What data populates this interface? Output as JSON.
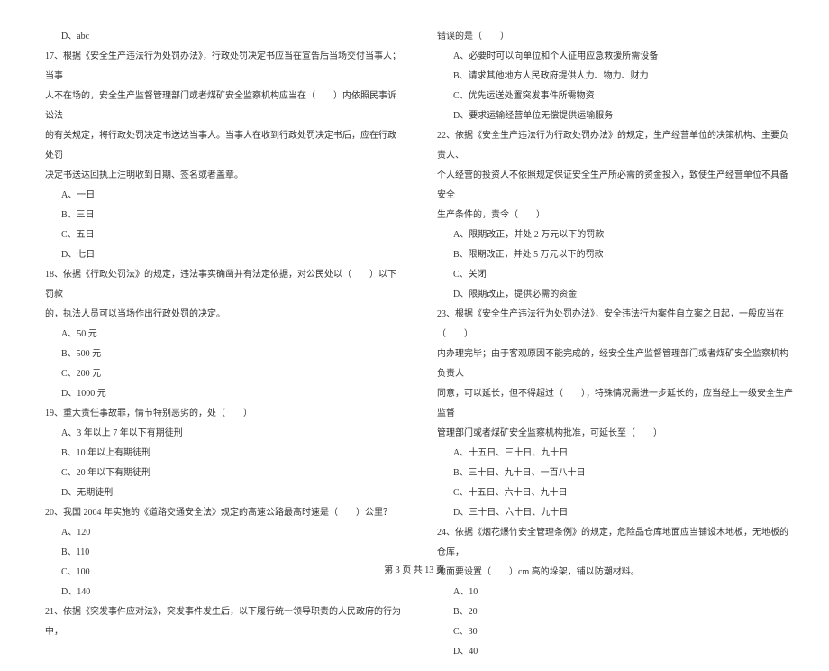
{
  "col1": {
    "lines": [
      {
        "cls": "indent-2",
        "t": "D、abc"
      },
      {
        "cls": "indent-1",
        "t": "17、根据《安全生产违法行为处罚办法》，行政处罚决定书应当在宣告后当场交付当事人；当事"
      },
      {
        "cls": "indent-1",
        "t": "人不在场的，安全生产监督管理部门或者煤矿安全监察机构应当在（　　）内依照民事诉讼法"
      },
      {
        "cls": "indent-1",
        "t": "的有关规定，将行政处罚决定书送达当事人。当事人在收到行政处罚决定书后，应在行政处罚"
      },
      {
        "cls": "indent-1",
        "t": "决定书送达回执上注明收到日期、签名或者盖章。"
      },
      {
        "cls": "indent-2",
        "t": "A、一日"
      },
      {
        "cls": "indent-2",
        "t": "B、三日"
      },
      {
        "cls": "indent-2",
        "t": "C、五日"
      },
      {
        "cls": "indent-2",
        "t": "D、七日"
      },
      {
        "cls": "indent-1",
        "t": "18、依据《行政处罚法》的规定，违法事实确凿并有法定依据，对公民处以（　　）以下罚款"
      },
      {
        "cls": "indent-1",
        "t": "的，执法人员可以当场作出行政处罚的决定。"
      },
      {
        "cls": "indent-2",
        "t": "A、50 元"
      },
      {
        "cls": "indent-2",
        "t": "B、500 元"
      },
      {
        "cls": "indent-2",
        "t": "C、200 元"
      },
      {
        "cls": "indent-2",
        "t": "D、1000 元"
      },
      {
        "cls": "indent-1",
        "t": "19、重大责任事故罪，情节特别恶劣的，处（　　）"
      },
      {
        "cls": "indent-2",
        "t": "A、3 年以上 7 年以下有期徒刑"
      },
      {
        "cls": "indent-2",
        "t": "B、10 年以上有期徒刑"
      },
      {
        "cls": "indent-2",
        "t": "C、20 年以下有期徒刑"
      },
      {
        "cls": "indent-2",
        "t": "D、无期徒刑"
      },
      {
        "cls": "indent-1",
        "t": "20、我国 2004 年实施的《道路交通安全法》规定的高速公路最高时速是（　　）公里？"
      },
      {
        "cls": "indent-2",
        "t": "A、120"
      },
      {
        "cls": "indent-2",
        "t": "B、110"
      },
      {
        "cls": "indent-2",
        "t": "C、100"
      },
      {
        "cls": "indent-2",
        "t": "D、140"
      },
      {
        "cls": "indent-1",
        "t": "21、依据《突发事件应对法》，突发事件发生后，以下履行统一领导职责的人民政府的行为中，"
      }
    ]
  },
  "col2": {
    "lines": [
      {
        "cls": "indent-1",
        "t": "错误的是（　　）"
      },
      {
        "cls": "indent-2",
        "t": "A、必要时可以向单位和个人征用应急救援所需设备"
      },
      {
        "cls": "indent-2",
        "t": "B、请求其他地方人民政府提供人力、物力、财力"
      },
      {
        "cls": "indent-2",
        "t": "C、优先运送处置突发事件所需物资"
      },
      {
        "cls": "indent-2",
        "t": "D、要求运输经营单位无偿提供运输服务"
      },
      {
        "cls": "indent-1",
        "t": "22、依据《安全生产违法行为行政处罚办法》的规定，生产经营单位的决策机构、主要负责人、"
      },
      {
        "cls": "indent-1",
        "t": "个人经营的投资人不依照规定保证安全生产所必需的资金投入，致使生产经营单位不具备安全"
      },
      {
        "cls": "indent-1",
        "t": "生产条件的，责令（　　）"
      },
      {
        "cls": "indent-2",
        "t": "A、限期改正，并处 2 万元以下的罚款"
      },
      {
        "cls": "indent-2",
        "t": "B、限期改正，并处 5 万元以下的罚款"
      },
      {
        "cls": "indent-2",
        "t": "C、关闭"
      },
      {
        "cls": "indent-2",
        "t": "D、限期改正，提供必需的资金"
      },
      {
        "cls": "indent-1",
        "t": "23、根据《安全生产违法行为处罚办法》，安全违法行为案件自立案之日起，一般应当在（　　）"
      },
      {
        "cls": "indent-1",
        "t": "内办理完毕；由于客观原因不能完成的，经安全生产监督管理部门或者煤矿安全监察机构负责人"
      },
      {
        "cls": "indent-1",
        "t": "同意，可以延长，但不得超过（　　）；特殊情况需进一步延长的，应当经上一级安全生产监督"
      },
      {
        "cls": "indent-1",
        "t": "管理部门或者煤矿安全监察机构批准，可延长至（　　）"
      },
      {
        "cls": "indent-2",
        "t": "A、十五日、三十日、九十日"
      },
      {
        "cls": "indent-2",
        "t": "B、三十日、九十日、一百八十日"
      },
      {
        "cls": "indent-2",
        "t": "C、十五日、六十日、九十日"
      },
      {
        "cls": "indent-2",
        "t": "D、三十日、六十日、九十日"
      },
      {
        "cls": "indent-1",
        "t": "24、依据《烟花爆竹安全管理条例》的规定，危险品仓库地面应当铺设木地板，无地板的仓库，"
      },
      {
        "cls": "indent-1",
        "t": "地面要设置（　　）cm 高的垛架，铺以防潮材料。"
      },
      {
        "cls": "indent-2",
        "t": "A、10"
      },
      {
        "cls": "indent-2",
        "t": "B、20"
      },
      {
        "cls": "indent-2",
        "t": "C、30"
      },
      {
        "cls": "indent-2",
        "t": "D、40"
      }
    ]
  },
  "footer": "第 3 页 共 13 页"
}
